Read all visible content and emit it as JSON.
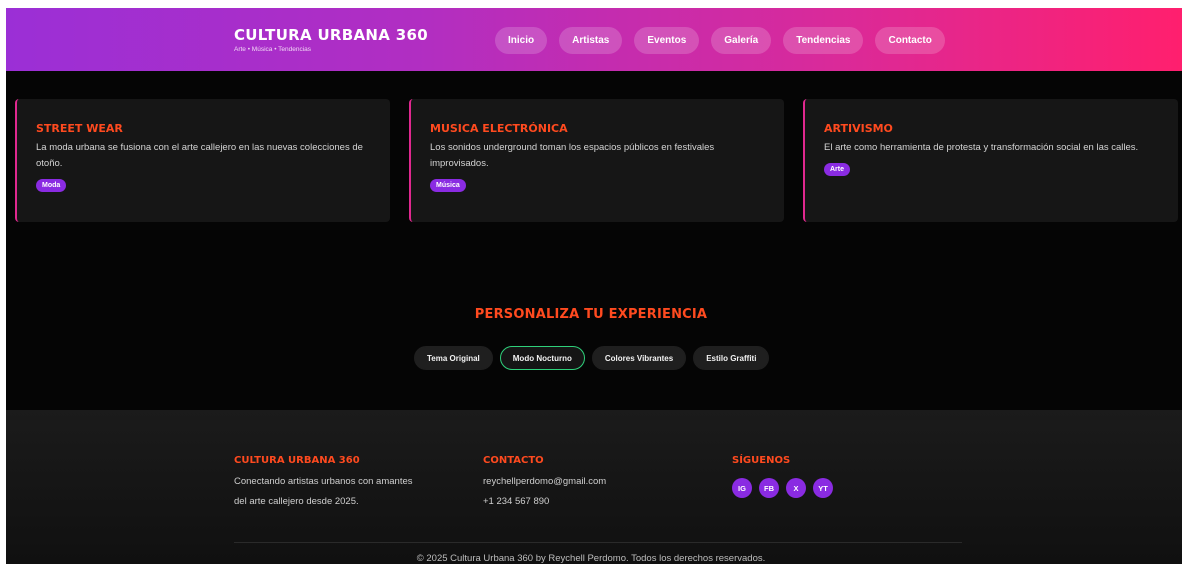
{
  "header": {
    "brand_title": "CULTURA URBANA 360",
    "brand_subtitle": "Arte • Música • Tendencias",
    "nav": [
      "Inicio",
      "Artistas",
      "Eventos",
      "Galería",
      "Tendencias",
      "Contacto"
    ]
  },
  "cards": [
    {
      "title": "STREET WEAR",
      "text": "La moda urbana se fusiona con el arte callejero en las nuevas colecciones de otoño.",
      "tag": "Moda"
    },
    {
      "title": "MUSICA ELECTRÓNICA",
      "text": "Los sonidos underground toman los espacios públicos en festivales improvisados.",
      "tag": "Música"
    },
    {
      "title": "ARTIVISMO",
      "text": "El arte como herramienta de protesta y transformación social en las calles.",
      "tag": "Arte"
    }
  ],
  "customize": {
    "title": "PERSONALIZA TU EXPERIENCIA",
    "themes": [
      "Tema Original",
      "Modo Nocturno",
      "Colores Vibrantes",
      "Estilo Graffiti"
    ],
    "active_theme": "Modo Nocturno"
  },
  "footer": {
    "about_title": "CULTURA URBANA 360",
    "about_line1": "Conectando artistas urbanos con amantes",
    "about_line2": "del arte callejero desde 2025.",
    "contact_title": "CONTACTO",
    "email": "reychellperdomo@gmail.com",
    "phone": "+1 234 567 890",
    "social_title": "SÍGUENOS",
    "social": [
      "IG",
      "FB",
      "X",
      "YT"
    ],
    "copyright": "© 2025 Cultura Urbana 360 by Reychell Perdomo. Todos los derechos reservados."
  },
  "colors": {
    "accent_orange": "#ff4a1f",
    "accent_purple": "#8a2be2",
    "header_gradient_start": "#9b2fd6",
    "header_gradient_end": "#ff1f6e",
    "active_border": "#2fd07a"
  }
}
